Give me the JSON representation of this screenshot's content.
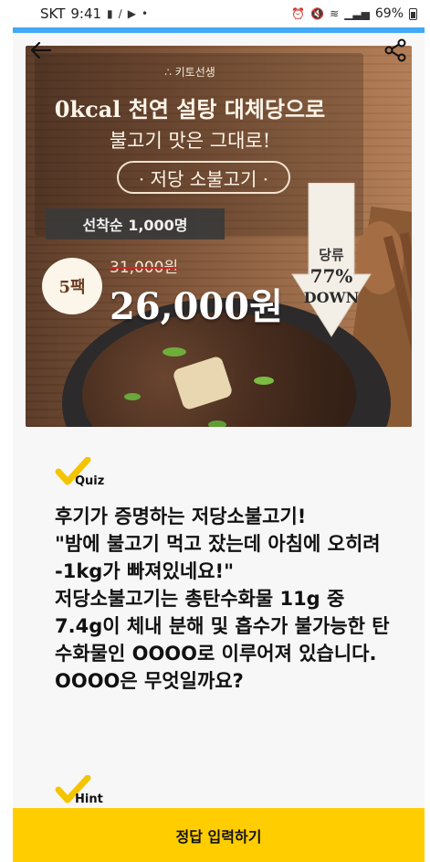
{
  "status_bar": {
    "carrier": "SKT",
    "time": "9:41",
    "battery": "69%"
  },
  "banner": {
    "brand": "∴ 키토선생",
    "headline_1": "0kcal 천연 설탕 대체당으로",
    "headline_2": "불고기 맛은 그대로!",
    "menu_name": "· 저당 소불고기 ·",
    "first_come": "선착순 1,000명",
    "pack_badge": "5팩",
    "old_price": "31,000원",
    "new_price": "26,000원",
    "sugar_label": "당류",
    "sugar_percent": "77%",
    "sugar_down": "DOWN"
  },
  "quiz": {
    "label": "Quiz",
    "question": "후기가 증명하는 저당소불고기!\n\"밤에 불고기 먹고 잤는데 아침에 오히려 -1kg가 빠져있네요!\"\n저당소불고기는 총탄수화물 11g 중 7.4g이 체내 분해 및 흡수가 불가능한 탄수화물인 OOOO로 이루어져 있습니다. OOOO은 무엇일까요?"
  },
  "hint": {
    "label": "Hint"
  },
  "submit_button": {
    "label": "정답 입력하기"
  },
  "icons": {
    "back": "back-arrow-icon",
    "share": "share-icon",
    "check": "check-mark-icon"
  },
  "colors": {
    "accent_line": "#41a9f5",
    "submit_bg": "#ffcd00",
    "check_yellow": "#f5c400"
  }
}
